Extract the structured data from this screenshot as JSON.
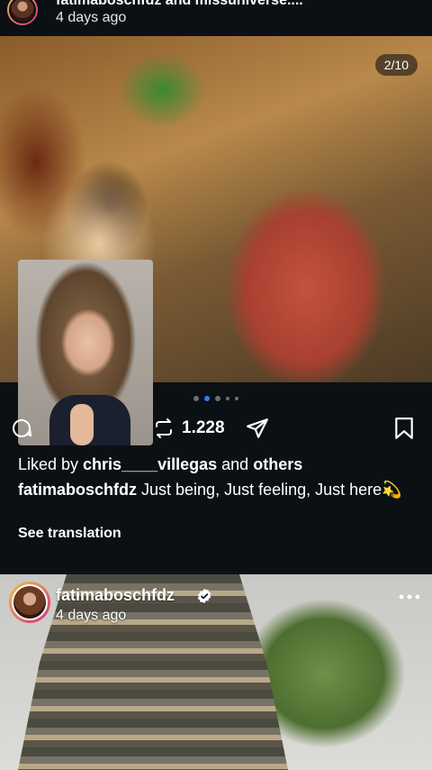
{
  "top_post": {
    "title": "fatimaboschfdz and missuniverse....",
    "time": "4 days ago"
  },
  "post": {
    "media_counter": "2/10",
    "carousel": {
      "total_dots": 5,
      "active_index": 1
    },
    "repost_count": "1.228",
    "likes": {
      "prefix": "Liked by ",
      "user": "chris____villegas",
      "middle": " and ",
      "others": "others"
    },
    "caption": {
      "user": "fatimaboschfdz",
      "text": " Just being, Just feeling, Just here💫"
    },
    "see_translation": "See translation"
  },
  "next_post": {
    "username": "fatimaboschfdz",
    "time": "4 days ago"
  },
  "colors": {
    "background": "#0b1014",
    "accent_blue": "#2f7ef6",
    "verified": "#ffffff"
  },
  "icons": [
    "comment-icon",
    "repost-icon",
    "share-icon",
    "save-icon",
    "verified-icon",
    "more-icon"
  ]
}
